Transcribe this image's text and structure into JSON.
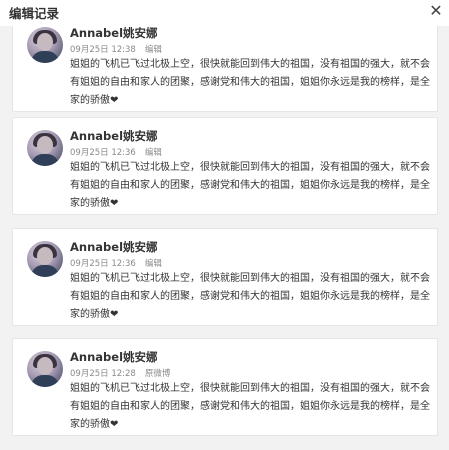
{
  "dialog": {
    "title": "编辑记录",
    "close_label": "✕"
  },
  "records": [
    {
      "name": "Annabel姚安娜",
      "time": "09月25日 12:38",
      "action": "编辑",
      "text": "姐姐的飞机已飞过北极上空，很快就能回到伟大的祖国，没有祖国的强大，就不会有姐姐的自由和家人的团聚，感谢党和伟大的祖国，姐姐你永远是我的榜样，是全家的骄傲❤"
    },
    {
      "name": "Annabel姚安娜",
      "time": "09月25日 12:36",
      "action": "编辑",
      "text": "姐姐的飞机已飞过北极上空，很快就能回到伟大的祖国，没有祖国的强大，就不会有姐姐的自由和家人的团聚，感谢党和伟大的祖国，姐姐你永远是我的榜样，是全家的骄傲❤"
    },
    {
      "name": "Annabel姚安娜",
      "time": "09月25日 12:36",
      "action": "编辑",
      "text": "姐姐的飞机已飞过北极上空，很快就能回到伟大的祖国，没有祖国的强大，就不会有姐姐的自由和家人的团聚，感谢党和伟大的祖国，姐姐你永远是我的榜样，是全家的骄傲❤"
    },
    {
      "name": "Annabel姚安娜",
      "time": "09月25日 12:28",
      "action": "原微博",
      "text": "姐姐的飞机已飞过北极上空，很快就能回到伟大的祖国，没有祖国的强大，就不会有姐姐的自由和家人的团聚，感谢党和伟大的祖国，姐姐你永远是我的榜样，是全家的骄傲❤"
    }
  ]
}
